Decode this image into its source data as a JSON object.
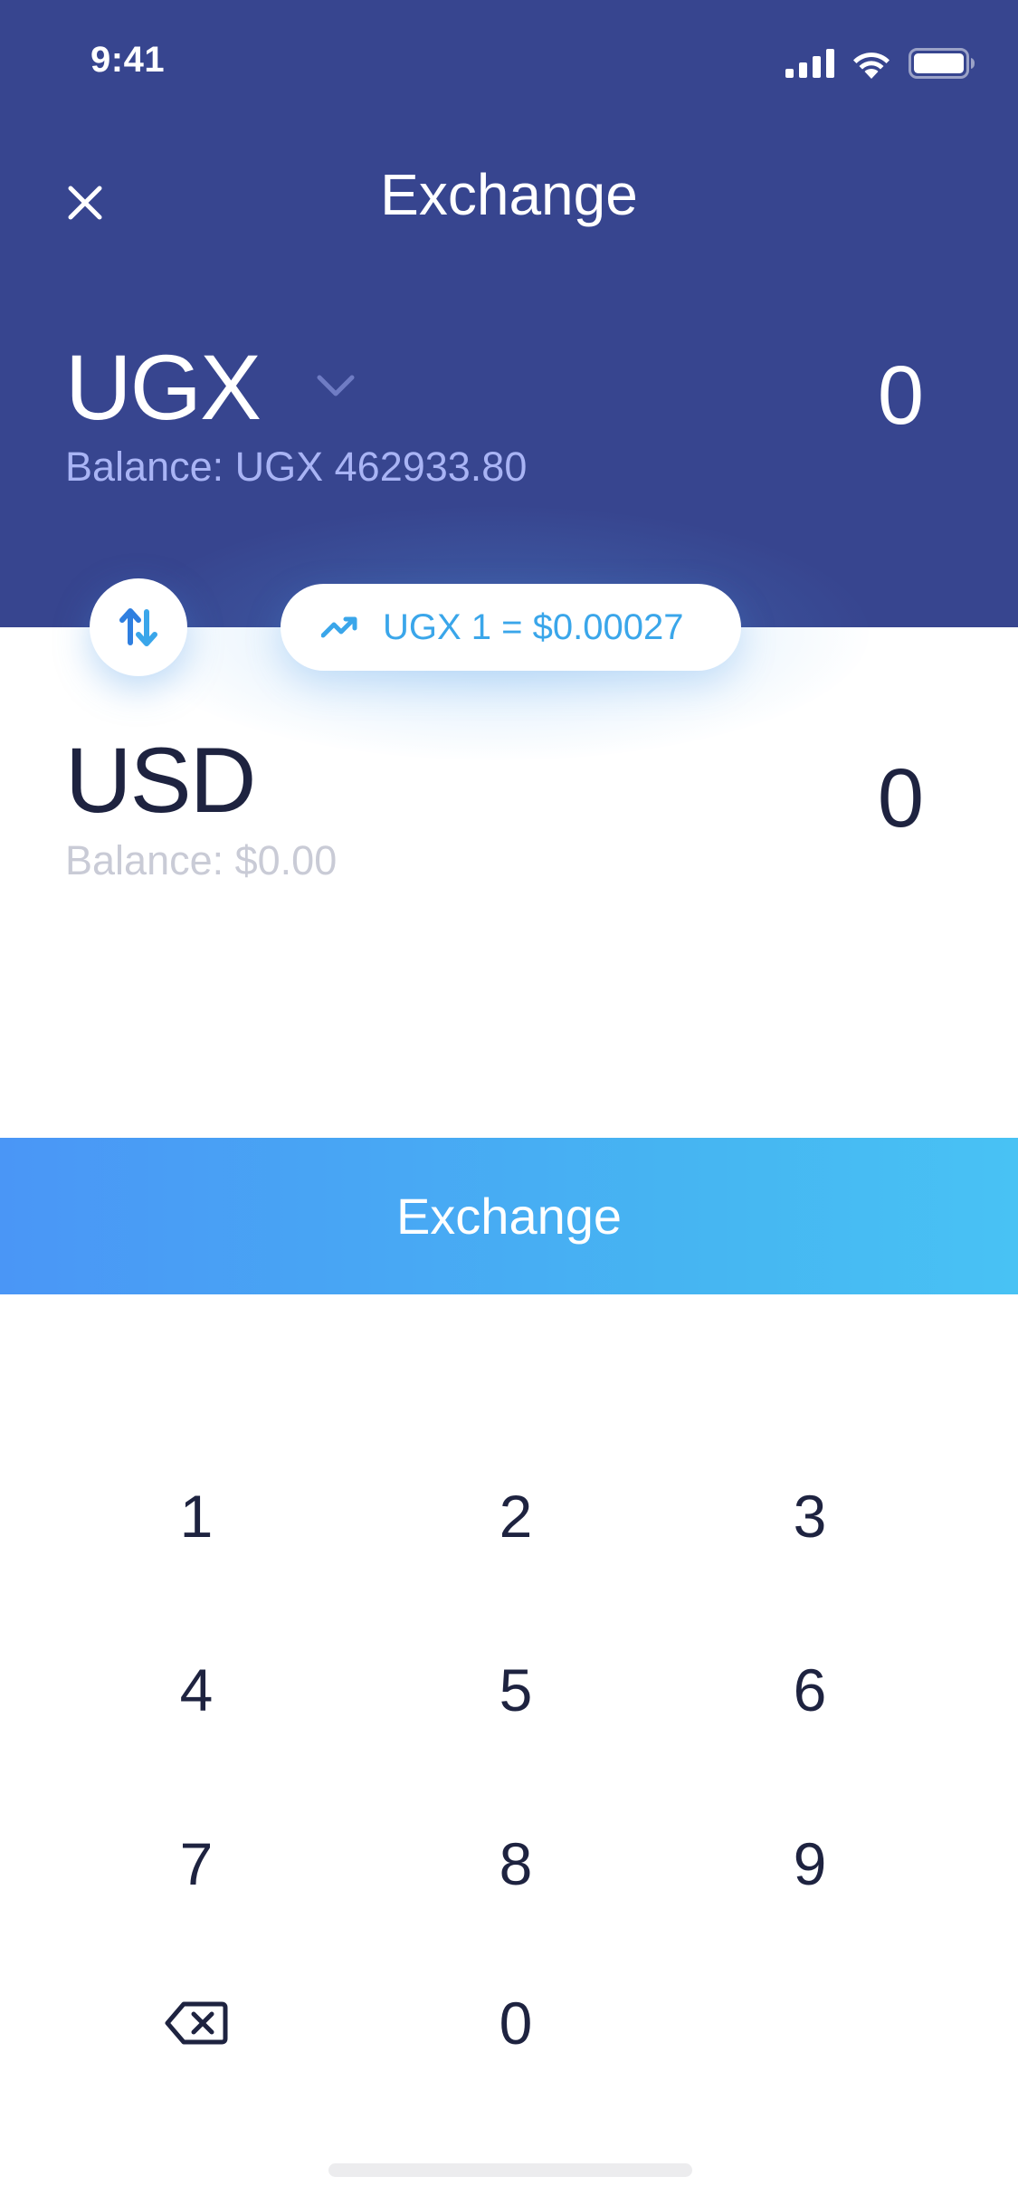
{
  "status_bar": {
    "time": "9:41"
  },
  "header": {
    "title": "Exchange",
    "close_icon": "close-icon"
  },
  "from_currency": {
    "code": "UGX",
    "balance": "Balance: UGX 462933.80",
    "amount": "0",
    "dropdown_icon": "chevron-down-icon"
  },
  "rate": {
    "icon": "trending-up-icon",
    "text": "UGX 1 = $0.00027"
  },
  "to_currency": {
    "code": "USD",
    "balance": "Balance: $0.00",
    "amount": "0"
  },
  "exchange_button": {
    "label": "Exchange"
  },
  "keypad": {
    "keys": [
      "1",
      "2",
      "3",
      "4",
      "5",
      "6",
      "7",
      "8",
      "9",
      "0"
    ],
    "delete_icon": "backspace-icon"
  },
  "colors": {
    "header_bg": "#37458f",
    "accent": "#3aa6ea",
    "button_gradient_start": "#4a96f6",
    "button_gradient_end": "#48c2f4",
    "text_dark": "#1e2340"
  }
}
